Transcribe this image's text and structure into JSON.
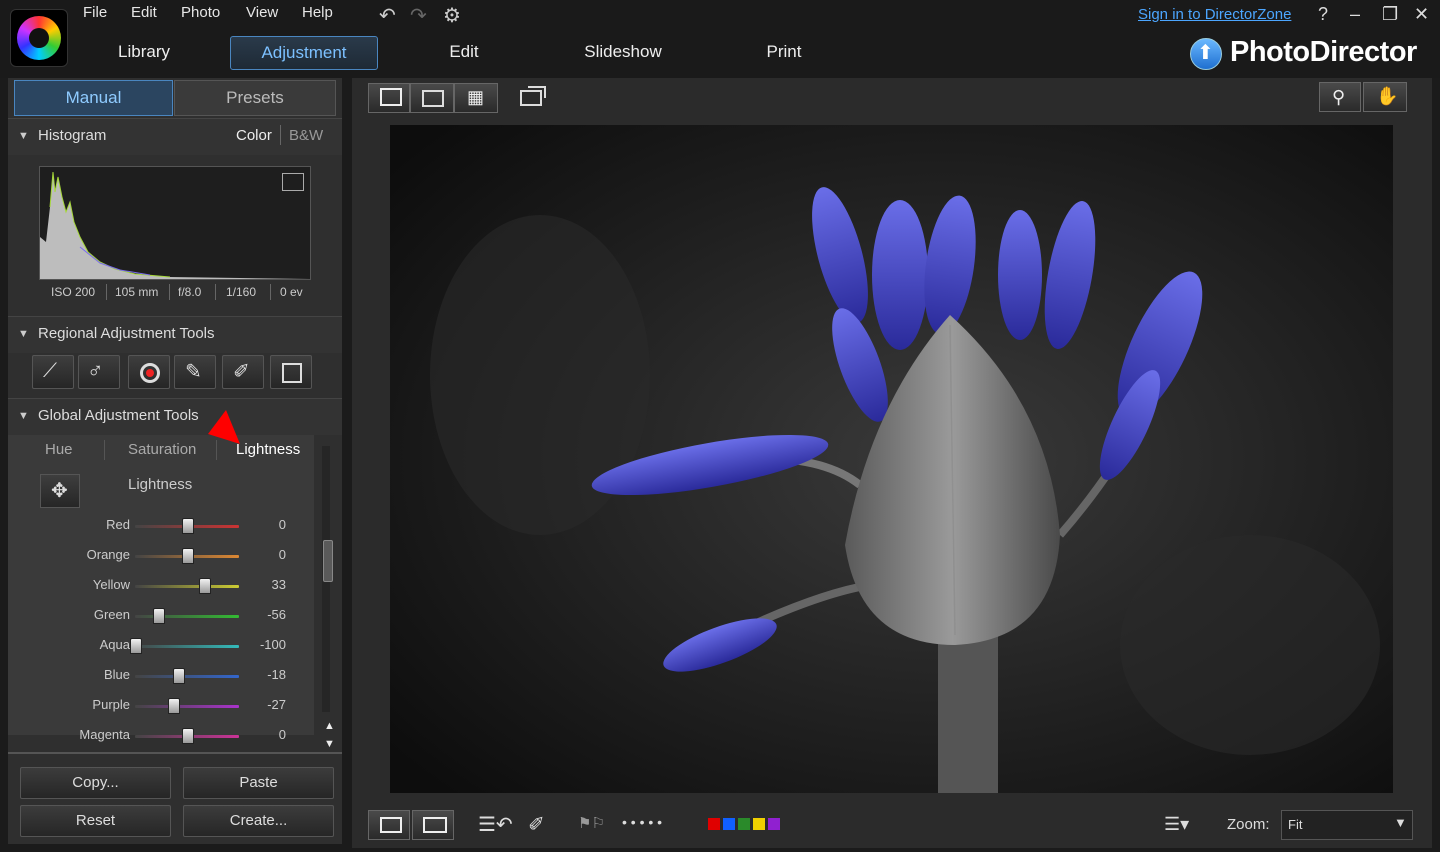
{
  "menu": {
    "file": "File",
    "edit": "Edit",
    "photo": "Photo",
    "view": "View",
    "help": "Help"
  },
  "nav": {
    "library": "Library",
    "adjustment": "Adjustment",
    "edit": "Edit",
    "slideshow": "Slideshow",
    "print": "Print"
  },
  "account": {
    "sign_in": "Sign in to DirectorZone"
  },
  "window": {
    "help": "?",
    "minimize": "–",
    "restore": "❐",
    "close": "✕"
  },
  "brand": {
    "name": "PhotoDirector"
  },
  "panel_tabs": {
    "manual": "Manual",
    "presets": "Presets"
  },
  "histogram": {
    "title": "Histogram",
    "color": "Color",
    "bw": "B&W",
    "exif": {
      "iso": "ISO 200",
      "focal": "105 mm",
      "aperture": "f/8.0",
      "shutter": "1/160",
      "ev": "0 ev"
    }
  },
  "regional": {
    "title": "Regional Adjustment Tools"
  },
  "global": {
    "title": "Global Adjustment Tools",
    "tabs": {
      "hue": "Hue",
      "saturation": "Saturation",
      "lightness": "Lightness"
    },
    "section_label": "Lightness",
    "range": [
      -100,
      100
    ],
    "sliders": [
      {
        "label": "Red",
        "value": 0,
        "valtext": "0",
        "gradient": "#444,#c33"
      },
      {
        "label": "Orange",
        "value": 0,
        "valtext": "0",
        "gradient": "#444,#d83"
      },
      {
        "label": "Yellow",
        "value": 33,
        "valtext": "33",
        "gradient": "#444,#cc3"
      },
      {
        "label": "Green",
        "value": -56,
        "valtext": "-56",
        "gradient": "#444,#3b3"
      },
      {
        "label": "Aqua",
        "value": -100,
        "valtext": "-100",
        "gradient": "#444,#3bb"
      },
      {
        "label": "Blue",
        "value": -18,
        "valtext": "-18",
        "gradient": "#444,#36c"
      },
      {
        "label": "Purple",
        "value": -27,
        "valtext": "-27",
        "gradient": "#444,#a3c"
      },
      {
        "label": "Magenta",
        "value": 0,
        "valtext": "0",
        "gradient": "#444,#c39"
      }
    ]
  },
  "buttons": {
    "copy": "Copy...",
    "paste": "Paste",
    "reset": "Reset",
    "create": "Create..."
  },
  "bottom": {
    "zoom_label": "Zoom:",
    "zoom_value": "Fit",
    "rating_dots": "• • • • •"
  },
  "color_labels": [
    "#e00000",
    "#1060ff",
    "#2a8a2a",
    "#f0d000",
    "#9020d0"
  ],
  "colors": {
    "accent": "#4a86c0",
    "tab_active_text": "#8fcbff",
    "link": "#4ca6ff"
  }
}
